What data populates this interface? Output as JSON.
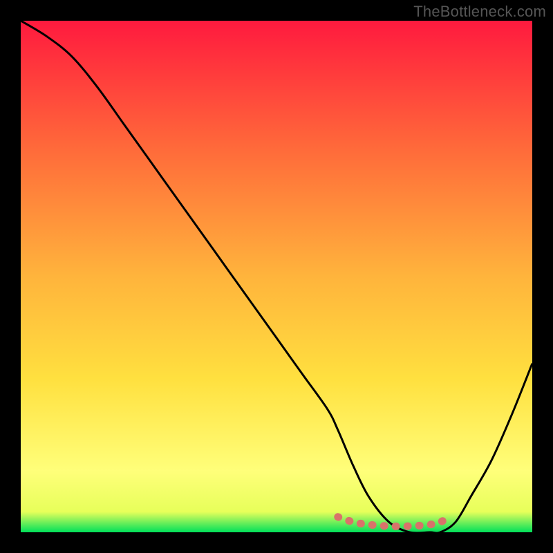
{
  "attribution": "TheBottleneck.com",
  "chart_data": {
    "type": "line",
    "title": "",
    "xlabel": "",
    "ylabel": "",
    "xlim": [
      0,
      100
    ],
    "ylim": [
      0,
      100
    ],
    "series": [
      {
        "name": "bottleneck-curve",
        "x": [
          0,
          5,
          10,
          15,
          20,
          25,
          30,
          35,
          40,
          45,
          50,
          55,
          60,
          62,
          65,
          68,
          72,
          76,
          80,
          82,
          85,
          88,
          92,
          96,
          100
        ],
        "y": [
          100,
          97,
          93,
          87,
          80,
          73,
          66,
          59,
          52,
          45,
          38,
          31,
          24,
          20,
          13,
          7,
          2,
          0,
          0,
          0,
          2,
          7,
          14,
          23,
          33
        ]
      },
      {
        "name": "optimal-zone",
        "x": [
          62,
          65,
          68,
          72,
          76,
          80,
          82,
          84
        ],
        "y": [
          3,
          2,
          1.5,
          1.2,
          1.2,
          1.5,
          2,
          3
        ]
      }
    ],
    "colors": {
      "gradient_top": "#ff1a3e",
      "gradient_bottom": "#00e05a",
      "curve": "#000000",
      "optimal_marker": "#d9726a"
    }
  }
}
